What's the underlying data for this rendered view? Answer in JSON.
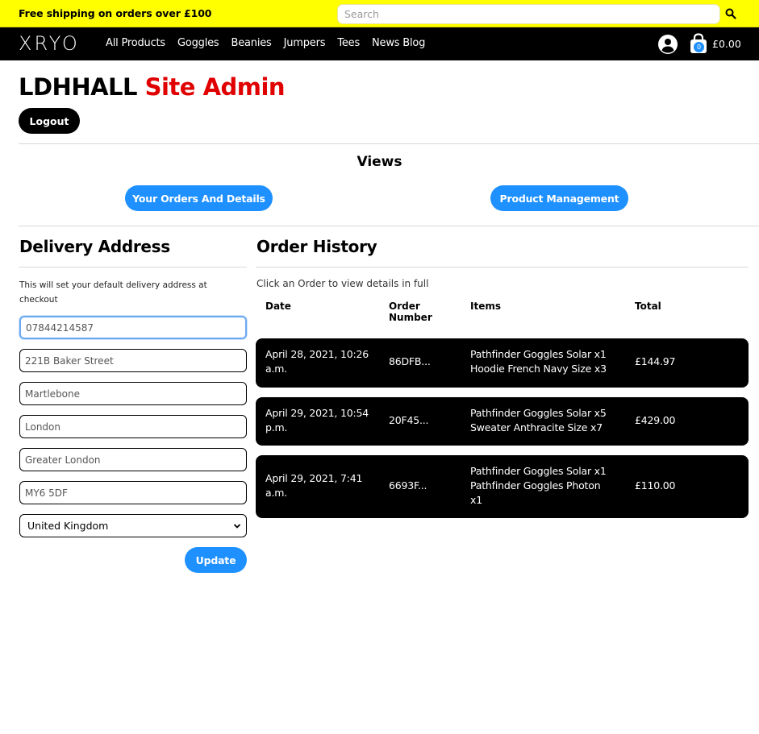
{
  "promo": {
    "text": "Free shipping on orders over £100"
  },
  "search": {
    "placeholder": "Search",
    "icon": "search-icon"
  },
  "nav": {
    "logo": "XRYO",
    "links": [
      "All Products",
      "Goggles",
      "Beanies",
      "Jumpers",
      "Tees",
      "News Blog"
    ],
    "cart_count": "0",
    "cart_total": "£0.00"
  },
  "admin": {
    "user": "LDHHALL",
    "role": "Site Admin",
    "logout_label": "Logout"
  },
  "views": {
    "title": "Views",
    "orders_label": "Your Orders And Details",
    "products_label": "Product Management"
  },
  "delivery": {
    "title": "Delivery Address",
    "note": "This will set your default delivery address at checkout",
    "fields": [
      "07844214587",
      "221B Baker Street",
      "Martlebone",
      "London",
      "Greater London",
      "MY6 5DF"
    ],
    "country": "United Kingdom",
    "update_label": "Update"
  },
  "orders": {
    "title": "Order History",
    "note": "Click an Order to view details in full",
    "columns": [
      "Date",
      "Order Number",
      "Items",
      "Total"
    ],
    "rows": [
      {
        "date": "April 28, 2021, 10:26 a.m.",
        "number": "86DFB...",
        "items": [
          "Pathfinder Goggles Solar x1",
          "Hoodie French Navy Size x3"
        ],
        "total": "£144.97"
      },
      {
        "date": "April 29, 2021, 10:54 p.m.",
        "number": "20F45...",
        "items": [
          "Pathfinder Goggles Solar x5",
          "Sweater Anthracite Size x7"
        ],
        "total": "£429.00"
      },
      {
        "date": "April 29, 2021, 7:41 a.m.",
        "number": "6693F...",
        "items": [
          "Pathfinder Goggles Solar x1",
          "Pathfinder Goggles Photon x1"
        ],
        "total": "£110.00"
      }
    ]
  },
  "colors": {
    "promo_bg": "#ffff00",
    "accent_blue": "#1e90ff",
    "admin_red": "#e00000"
  }
}
